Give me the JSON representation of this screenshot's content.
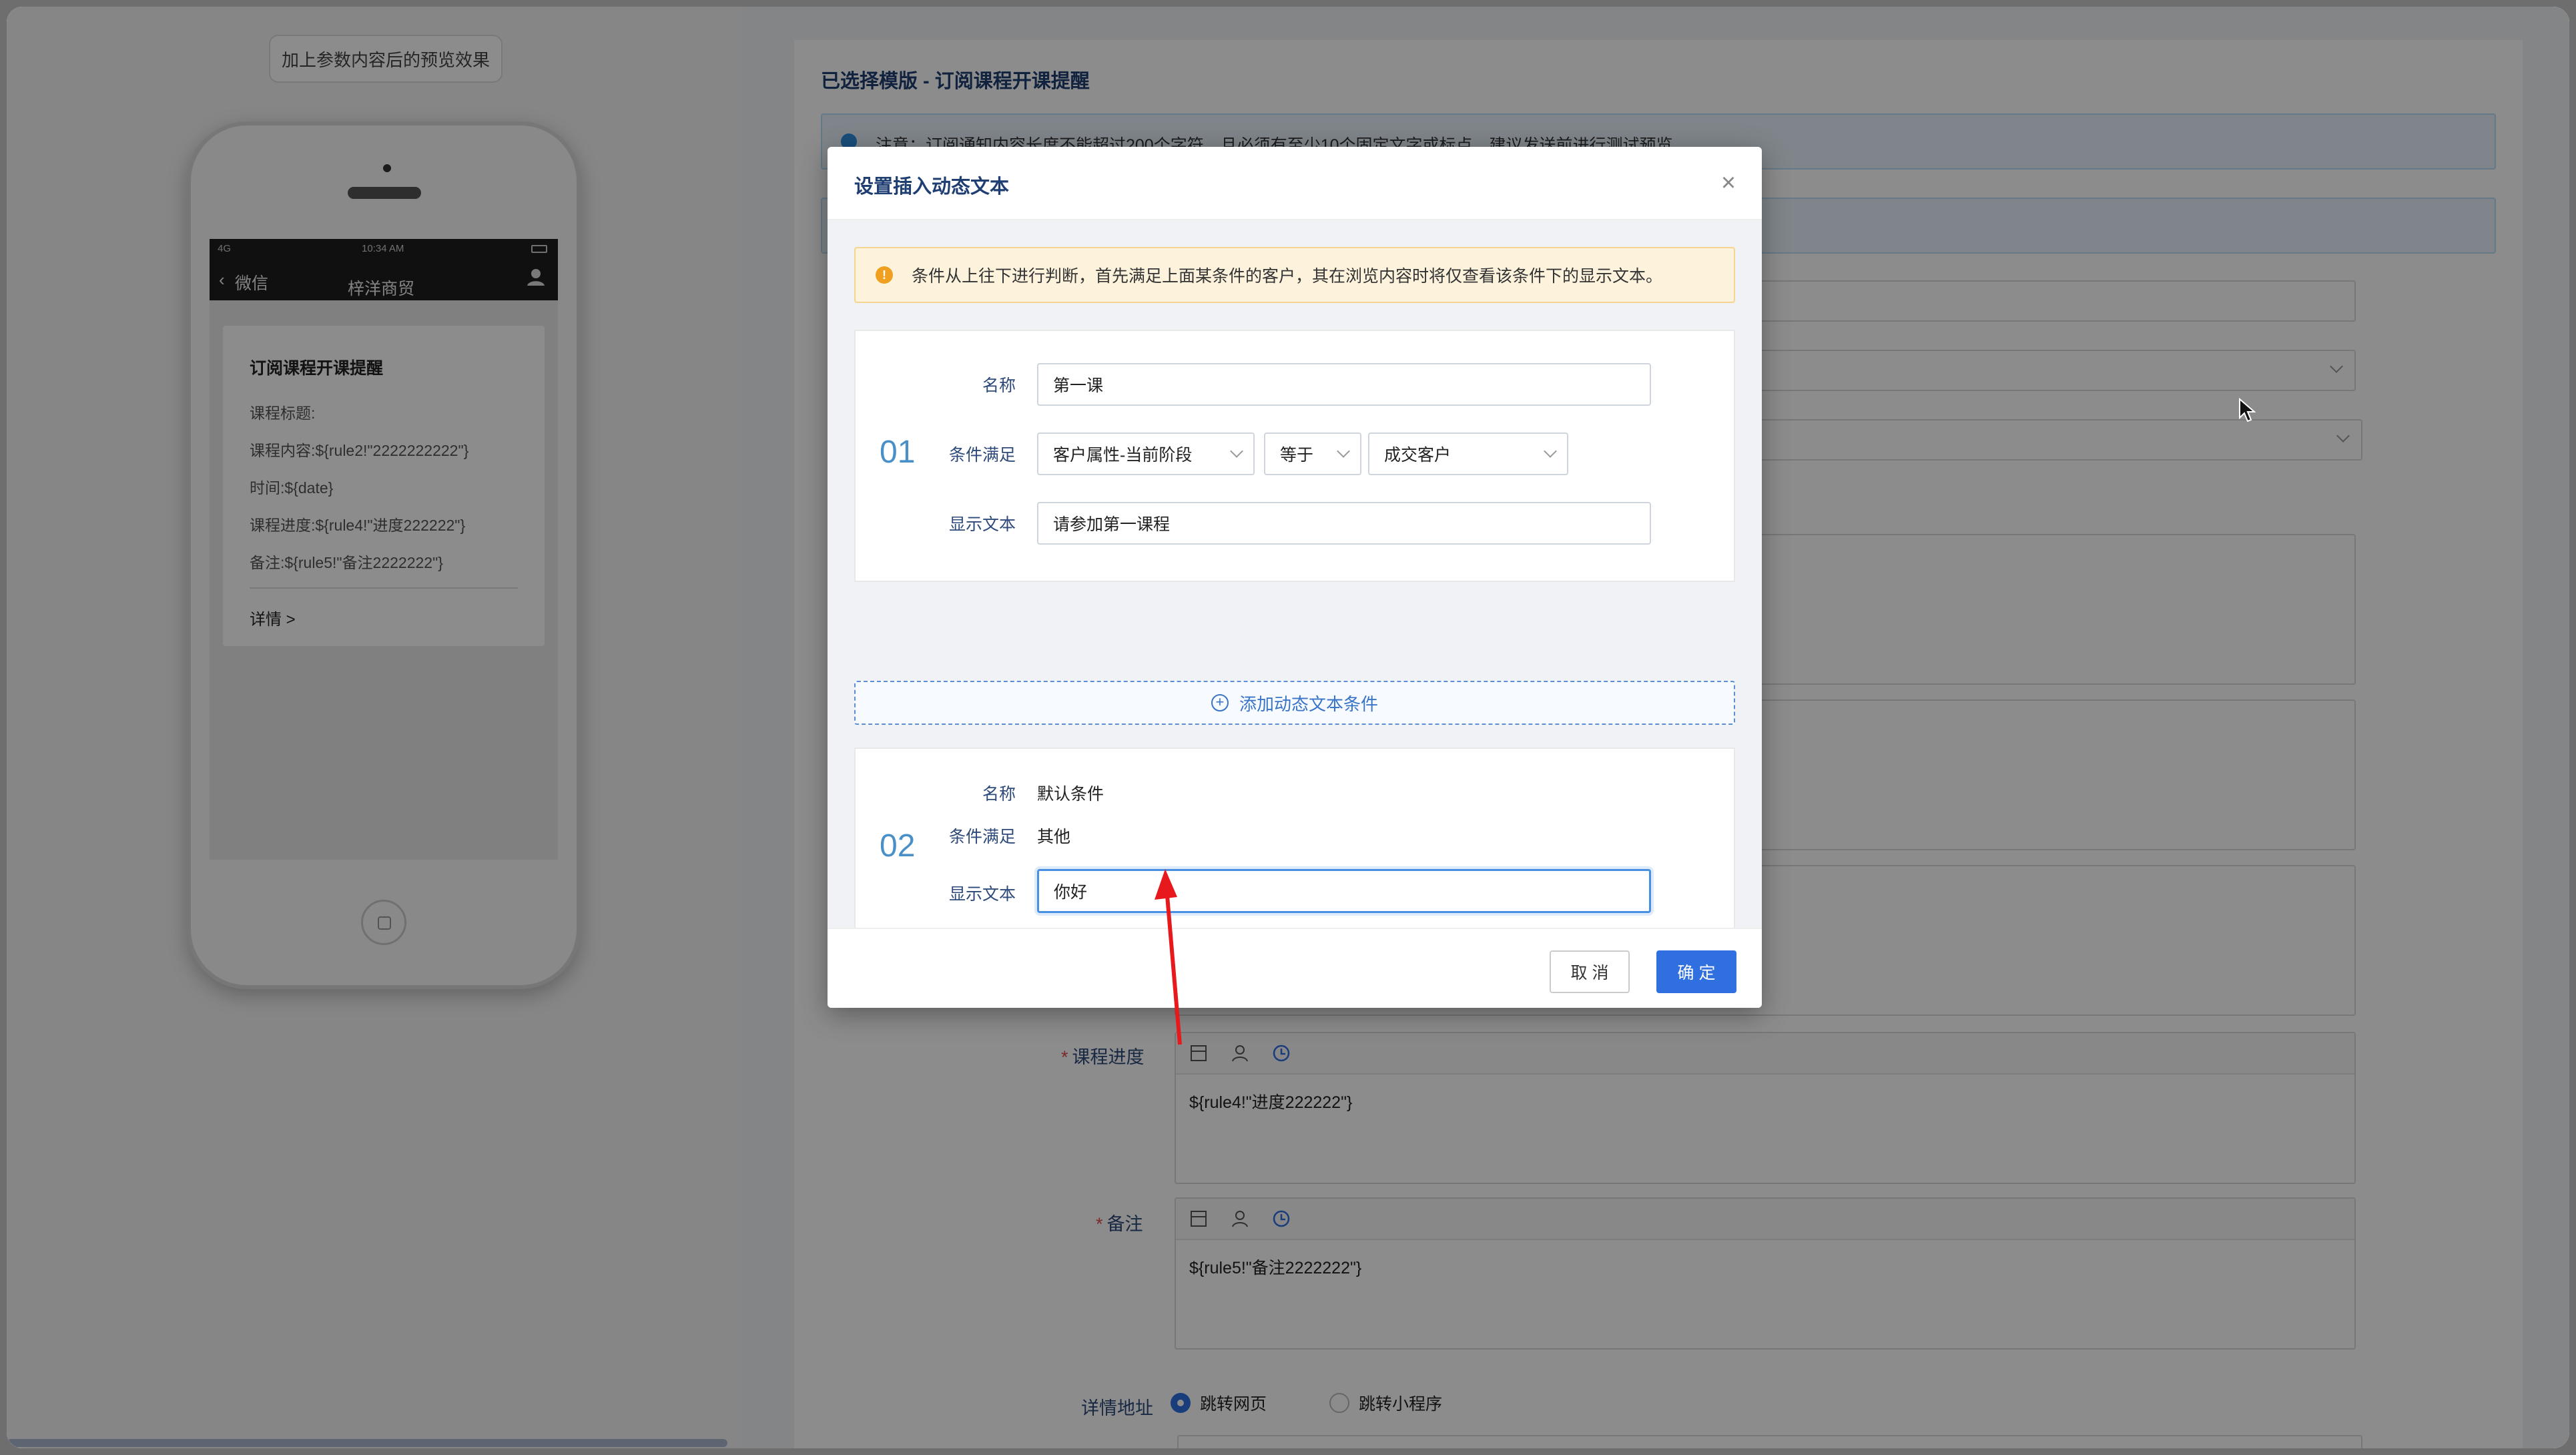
{
  "preview": {
    "tag": "加上参数内容后的预览效果",
    "status_left": "4G",
    "status_time": "10:34 AM",
    "back_label": "微信",
    "nav_title": "梓洋商贸",
    "card": {
      "title": "订阅课程开课提醒",
      "lines": [
        "课程标题:",
        "课程内容:${rule2!\"2222222222\"}",
        "时间:${date}",
        "课程进度:${rule4!\"进度222222\"}",
        "备注:${rule5!\"备注2222222\"}"
      ],
      "detail": "详情 >"
    }
  },
  "form": {
    "template_heading": "已选择模版 - 订阅课程开课提醒",
    "notice": "注意：订阅通知内容长度不能超过200个字符，且必须有至少10个固定文字或标点，建议发送前进行测试预览。",
    "progress_label": "课程进度",
    "progress_value": "${rule4!\"进度222222\"}",
    "remark_label": "备注",
    "remark_value": "${rule5!\"备注2222222\"}",
    "detail_label": "详情地址",
    "radio_web": "跳转网页",
    "radio_mini": "跳转小程序"
  },
  "modal": {
    "title": "设置插入动态文本",
    "close": "×",
    "warning": "条件从上往下进行判断，首先满足上面某条件的客户，其在浏览内容时将仅查看该条件下的显示文本。",
    "cond1": {
      "num": "01",
      "name_label": "名称",
      "name_value": "第一课",
      "cond_label": "条件满足",
      "field": "客户属性-当前阶段",
      "op": "等于",
      "value": "成交客户",
      "text_label": "显示文本",
      "text_value": "请参加第一课程"
    },
    "add_label": "添加动态文本条件",
    "cond2": {
      "num": "02",
      "name_label": "名称",
      "name_value": "默认条件",
      "cond_label": "条件满足",
      "cond_value": "其他",
      "text_label": "显示文本",
      "text_value": "你好"
    },
    "cancel": "取 消",
    "ok": "确 定"
  },
  "colors": {
    "primary": "#2f6fe0",
    "warning_bg": "#fdf3dd",
    "arrow": "#e8191c"
  }
}
